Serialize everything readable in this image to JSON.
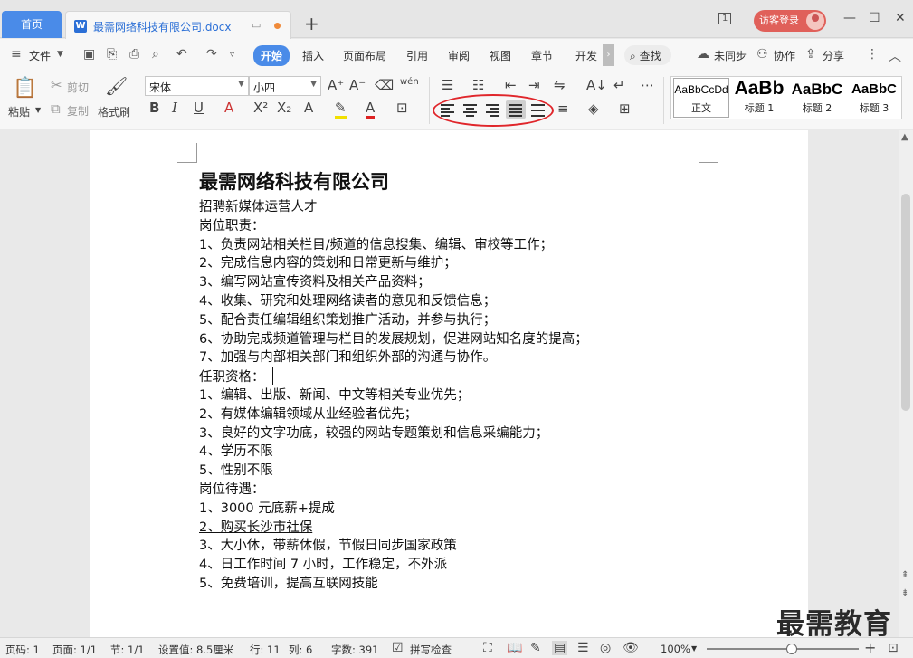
{
  "tabs": {
    "home": "首页",
    "document": "最需网络科技有限公司.docx",
    "monitor_icon": "monitor-icon",
    "new_tab": "+"
  },
  "titlebar": {
    "page_count_badge": "1",
    "login_label": "访客登录",
    "minimize": "—",
    "maximize": "☐",
    "close": "✕"
  },
  "menu": {
    "file": "文件",
    "items": [
      "开始",
      "插入",
      "页面布局",
      "引用",
      "审阅",
      "视图",
      "章节",
      "开发"
    ],
    "search": "查找",
    "unsynced": "未同步",
    "collab": "协作",
    "share": "分享"
  },
  "ribbon": {
    "paste": "粘贴",
    "cut": "剪切",
    "copy": "复制",
    "format_painter": "格式刷",
    "font_name": "宋体",
    "font_size": "小四",
    "styles": [
      {
        "preview": "AaBbCcDd",
        "label": "正文"
      },
      {
        "preview": "AaBb",
        "label": "标题 1"
      },
      {
        "preview": "AaBbC",
        "label": "标题 2"
      },
      {
        "preview": "AaBbC",
        "label": "标题 3"
      }
    ]
  },
  "document": {
    "title": "最需网络科技有限公司",
    "lines": [
      "招聘新媒体运营人才",
      "岗位职责：",
      "1、负责网站相关栏目/频道的信息搜集、编辑、审校等工作；",
      "2、完成信息内容的策划和日常更新与维护；",
      "3、编写网站宣传资料及相关产品资料；",
      "4、收集、研究和处理网络读者的意见和反馈信息；",
      "5、配合责任编辑组织策划推广活动，并参与执行；",
      "6、协助完成频道管理与栏目的发展规划，促进网站知名度的提高；",
      "7、加强与内部相关部门和组织外部的沟通与协作。",
      "任职资格：",
      "1、编辑、出版、新闻、中文等相关专业优先；",
      "2、有媒体编辑领域从业经验者优先；",
      "3、良好的文字功底，较强的网站专题策划和信息采编能力；",
      "4、学历不限",
      "5、性别不限",
      "岗位待遇：",
      "1、3000 元底薪+提成",
      "2、购买长沙市社保",
      "3、大小休，带薪休假，节假日同步国家政策",
      "4、日工作时间 7 小时，工作稳定，不外派",
      "5、免费培训，提高互联网技能"
    ]
  },
  "watermark": "最需教育",
  "status": {
    "page_num": "页码: 1",
    "pages": "页面: 1/1",
    "section": "节: 1/1",
    "setting": "设置值: 8.5厘米",
    "row": "行: 11",
    "col": "列: 6",
    "word_count": "字数: 391",
    "spell_check": "拼写检查",
    "zoom": "100%"
  }
}
